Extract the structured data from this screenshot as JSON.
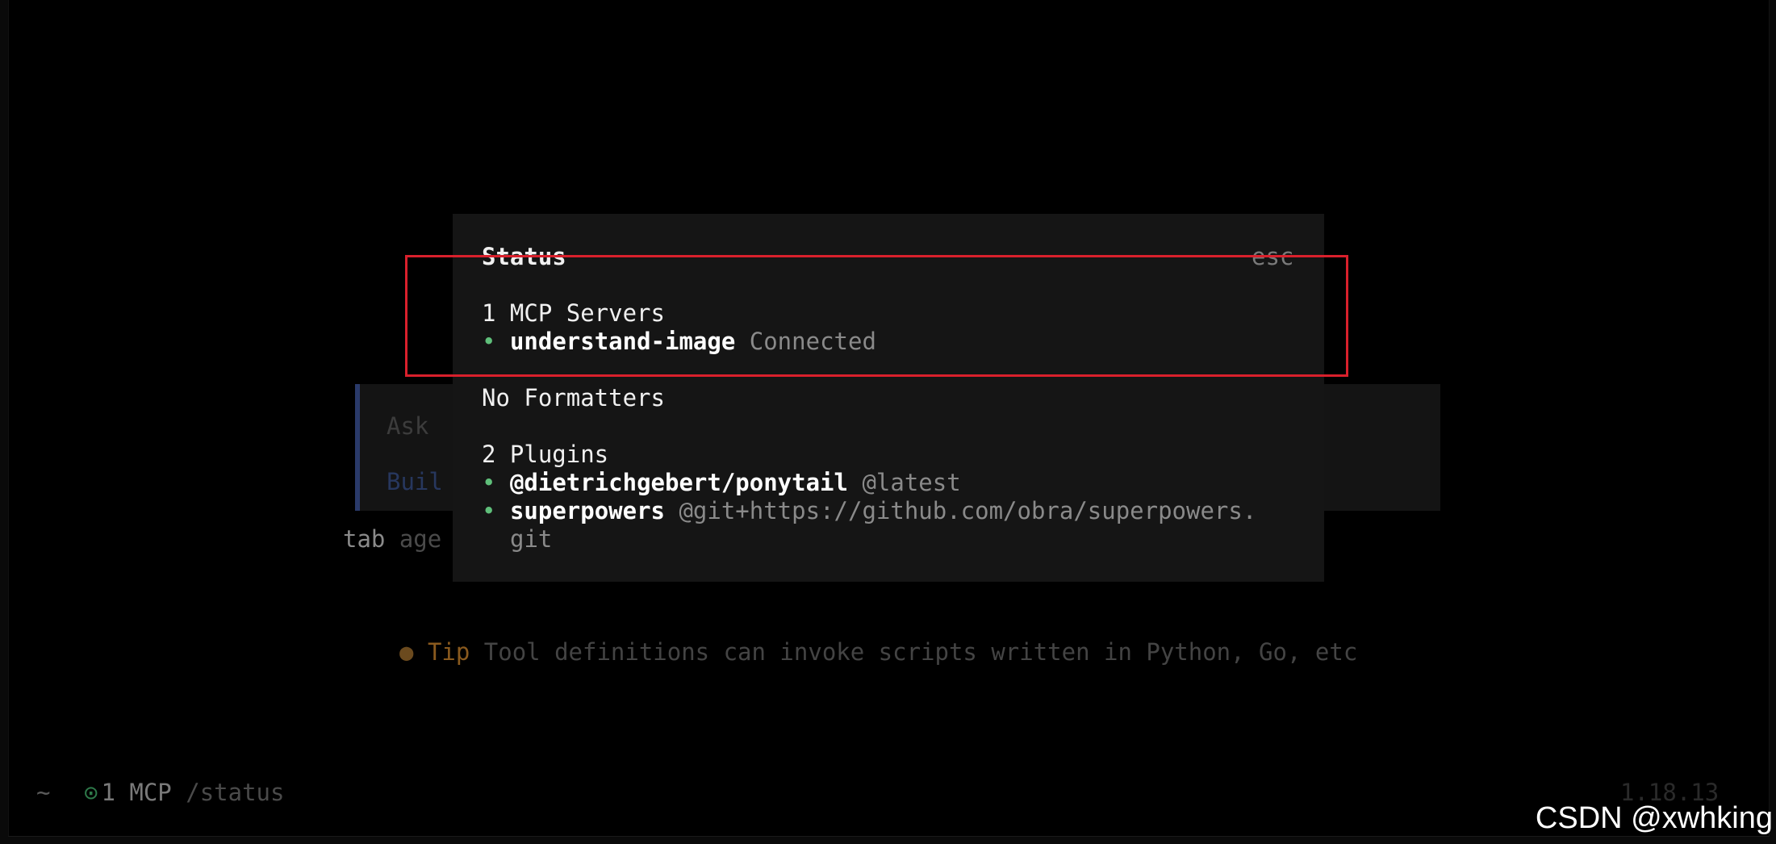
{
  "background": {
    "prompt_line1": "Ask",
    "prompt_line2": "Buil",
    "tab_key": "tab",
    "tab_rest": " age",
    "tip_dot": "●",
    "tip_word": "Tip",
    "tip_text": " Tool definitions can invoke scripts written in Python, Go, etc"
  },
  "footer": {
    "tilde": "~",
    "mcp_icon": "⊙",
    "mcp_label": "1 MCP",
    "status_cmd": "/status",
    "version": "1.18.13"
  },
  "dialog": {
    "title": "Status",
    "close_label": "esc",
    "mcp_header": "1 MCP Servers",
    "mcp_servers": [
      {
        "bullet": "•",
        "name": "understand-image",
        "state": "Connected"
      }
    ],
    "formatters_header": "No Formatters",
    "plugins_header": "2 Plugins",
    "plugins": [
      {
        "bullet": "•",
        "name": "@dietrichgebert/ponytail",
        "version": "@latest"
      },
      {
        "bullet": "•",
        "name": "superpowers",
        "version": "@git+https://github.com/obra/superpowers.",
        "version_cont": "git"
      }
    ]
  },
  "watermark": "CSDN @xwhking",
  "colors": {
    "highlight_border": "#d9202c",
    "bullet": "#5fbf7a",
    "dialog_bg": "#151515",
    "accent_bar": "#2a3a6a"
  }
}
